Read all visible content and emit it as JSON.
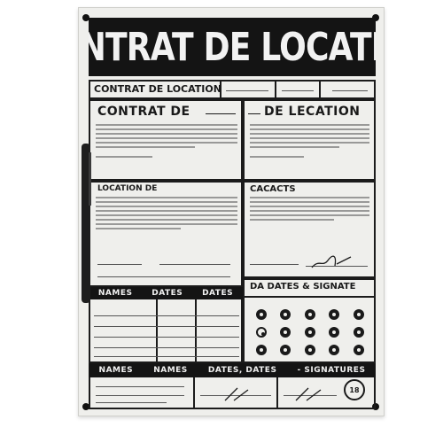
{
  "document": {
    "main_title": "CONTRAT DE LOCATION",
    "header_bar_label": "CONTRAT DE LOCATION",
    "section_left_title": "CONTRAT DE",
    "section_right_title": "DE LECATION",
    "left_mid_heading": "LOCATION DE",
    "right_mid_heading": "CACACTS",
    "dates_signature_heading": "DA DATES & SIGNATE",
    "left_table_headers": [
      "NAMES",
      "DATES",
      "DATES"
    ],
    "footer_headers": [
      "NAMES",
      "NAMES",
      "DATES, DATES",
      "- SIGNATURES"
    ],
    "seal_text": "18"
  }
}
